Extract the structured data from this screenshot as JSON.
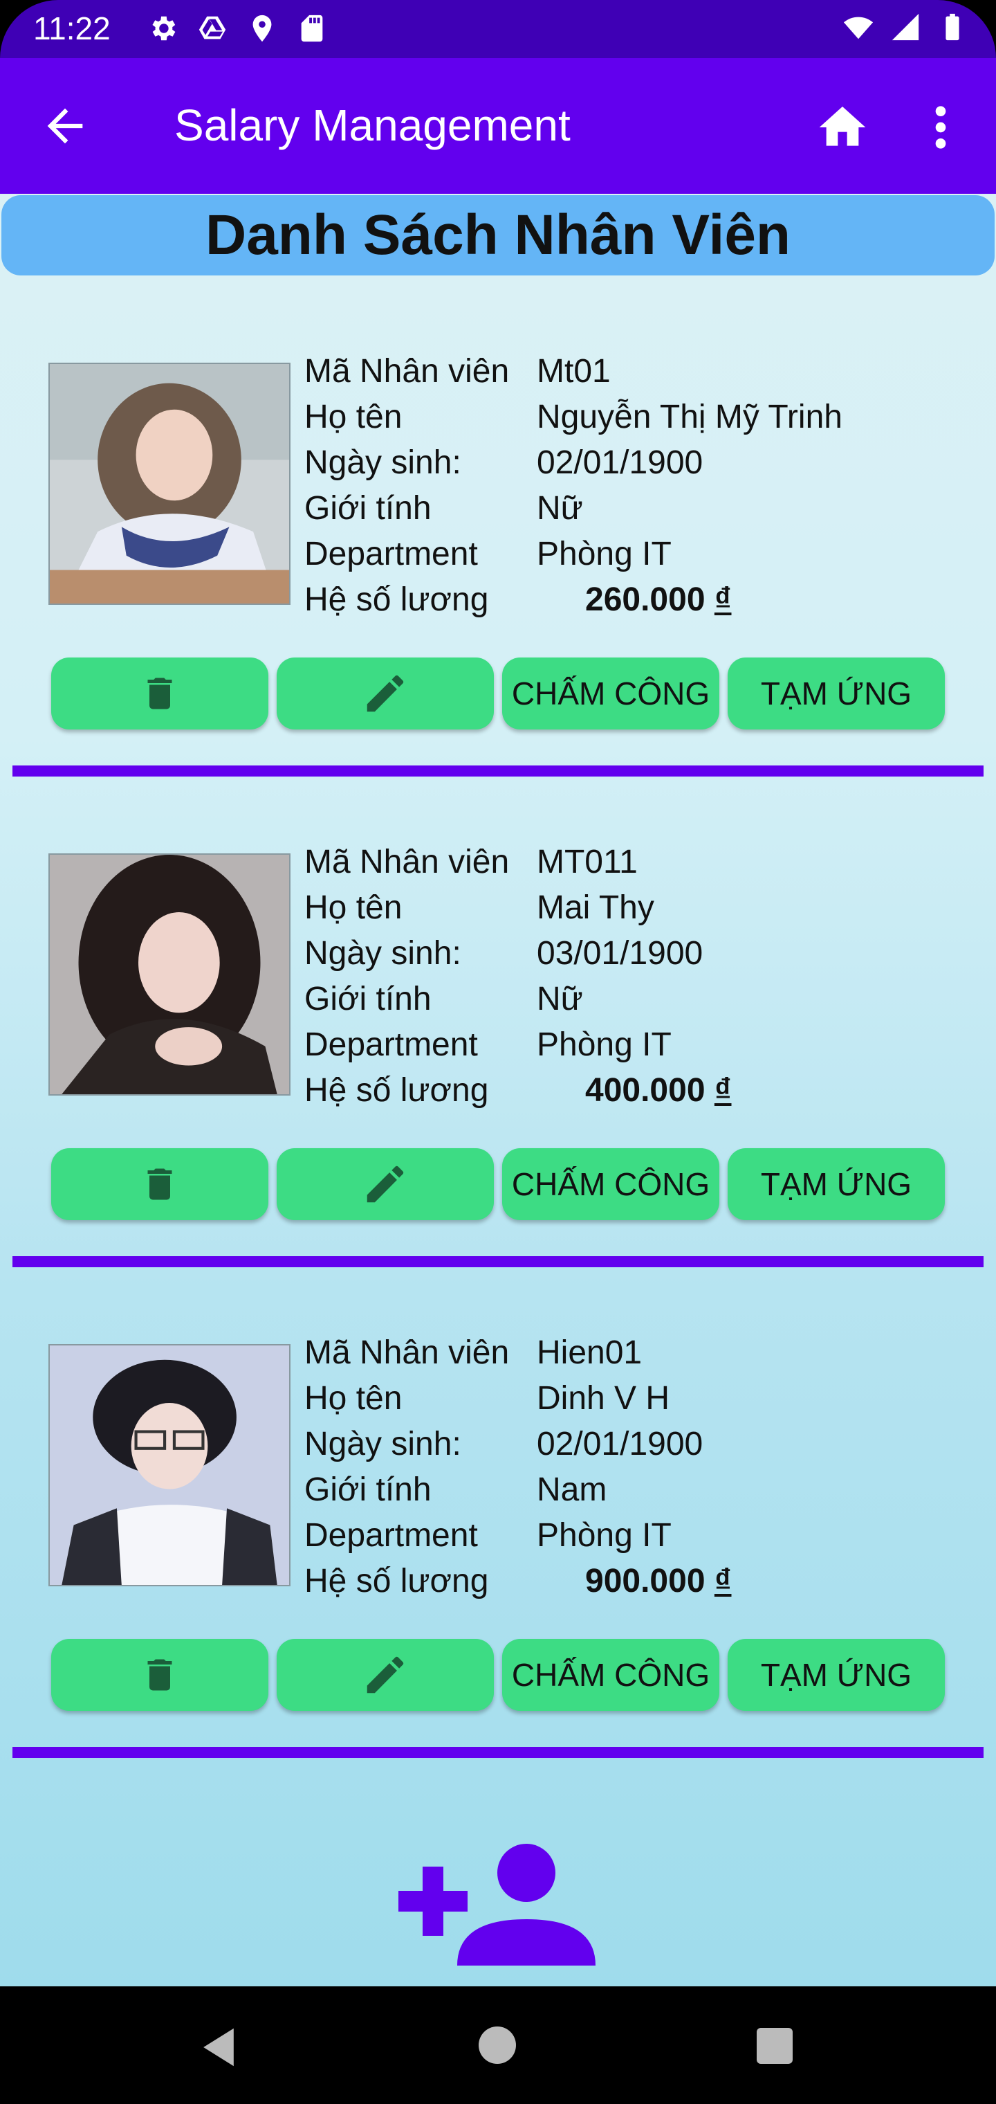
{
  "status_bar": {
    "time": "11:22",
    "left_icons": [
      "gear-icon",
      "drive-icon",
      "location-icon",
      "sdcard-icon"
    ],
    "right_icons": [
      "wifi-icon",
      "signal-icon",
      "battery-icon"
    ]
  },
  "app_bar": {
    "title": "Salary Management",
    "back_icon": "arrow-back-icon",
    "home_icon": "home-icon",
    "more_icon": "more-vert-icon"
  },
  "list_header": "Danh Sách Nhân Viên",
  "field_labels": {
    "id": "Mã Nhân viên",
    "name": "Họ tên",
    "dob": "Ngày sinh:",
    "gender": "Giới tính",
    "department": "Department",
    "salary_coef": "Hệ số lương"
  },
  "buttons": {
    "delete_icon": "trash-icon",
    "edit_icon": "pencil-icon",
    "attendance": "CHẤM CÔNG",
    "advance": "TẠM ỨNG"
  },
  "employees": [
    {
      "id": "Mt01",
      "name": "Nguyễn Thị Mỹ Trinh",
      "dob": "02/01/1900",
      "gender": "Nữ",
      "department": "Phòng IT",
      "salary_amount": "260.000",
      "currency": "₫"
    },
    {
      "id": "MT011",
      "name": "Mai Thy",
      "dob": "03/01/1900",
      "gender": "Nữ",
      "department": "Phòng IT",
      "salary_amount": "400.000",
      "currency": "₫"
    },
    {
      "id": "Hien01",
      "name": "Dinh V H",
      "dob": "02/01/1900",
      "gender": "Nam",
      "department": "Phòng IT",
      "salary_amount": "900.000",
      "currency": "₫"
    }
  ],
  "fab_icon": "add-person-icon",
  "colors": {
    "status_bar": "#3f00b5",
    "app_bar": "#6200ee",
    "header_banner": "#64b5f6",
    "button_green": "#3ddc84",
    "divider": "#6200ee"
  },
  "nav_bar": {
    "back": "nav-back-icon",
    "home": "nav-home-icon",
    "recents": "nav-recents-icon"
  }
}
